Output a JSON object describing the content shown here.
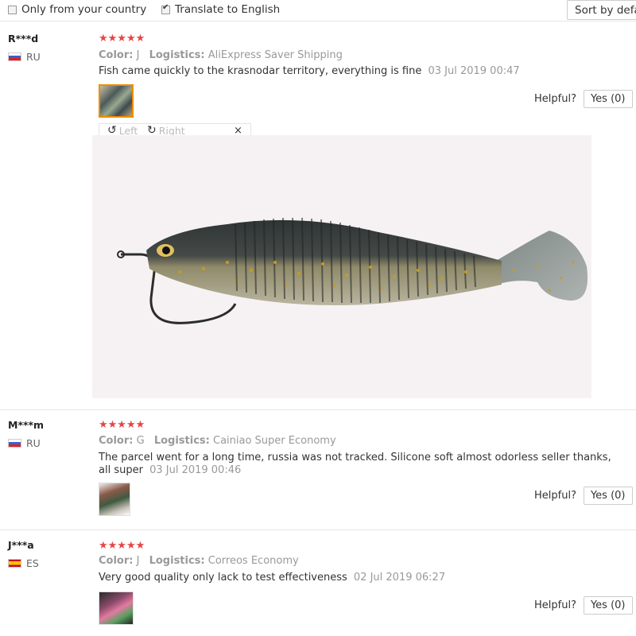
{
  "filters": {
    "only_country": {
      "label": "Only from your country",
      "checked": false
    },
    "translate": {
      "label": "Translate to English",
      "checked": true
    },
    "sort_label": "Sort by default"
  },
  "viewer": {
    "left_label": "Left",
    "right_label": "Right",
    "close_glyph": "×"
  },
  "reviews": [
    {
      "user": "R***d",
      "country": "RU",
      "stars": "★★★★★",
      "color_key": "Color:",
      "color_val": "J",
      "logistics_key": "Logistics:",
      "logistics_val": "AliExpress Saver Shipping",
      "text": "Fish came quickly to the krasnodar territory, everything is fine",
      "date": "03 Jul 2019 00:47",
      "helpful_label": "Helpful?",
      "yes_label": "Yes (0)"
    },
    {
      "user": "M***m",
      "country": "RU",
      "stars": "★★★★★",
      "color_key": "Color:",
      "color_val": "G",
      "logistics_key": "Logistics:",
      "logistics_val": "Cainiao Super Economy",
      "text": "The parcel went for a long time, russia was not tracked. Silicone soft almost odorless seller thanks, all super",
      "date": "03 Jul 2019 00:46",
      "helpful_label": "Helpful?",
      "yes_label": "Yes (0)"
    },
    {
      "user": "J***a",
      "country": "ES",
      "stars": "★★★★★",
      "color_key": "Color:",
      "color_val": "J",
      "logistics_key": "Logistics:",
      "logistics_val": "Correos Economy",
      "text": "Very good quality only lack to test effectiveness",
      "date": "02 Jul 2019 06:27",
      "helpful_label": "Helpful?",
      "yes_label": "Yes (0)"
    }
  ]
}
